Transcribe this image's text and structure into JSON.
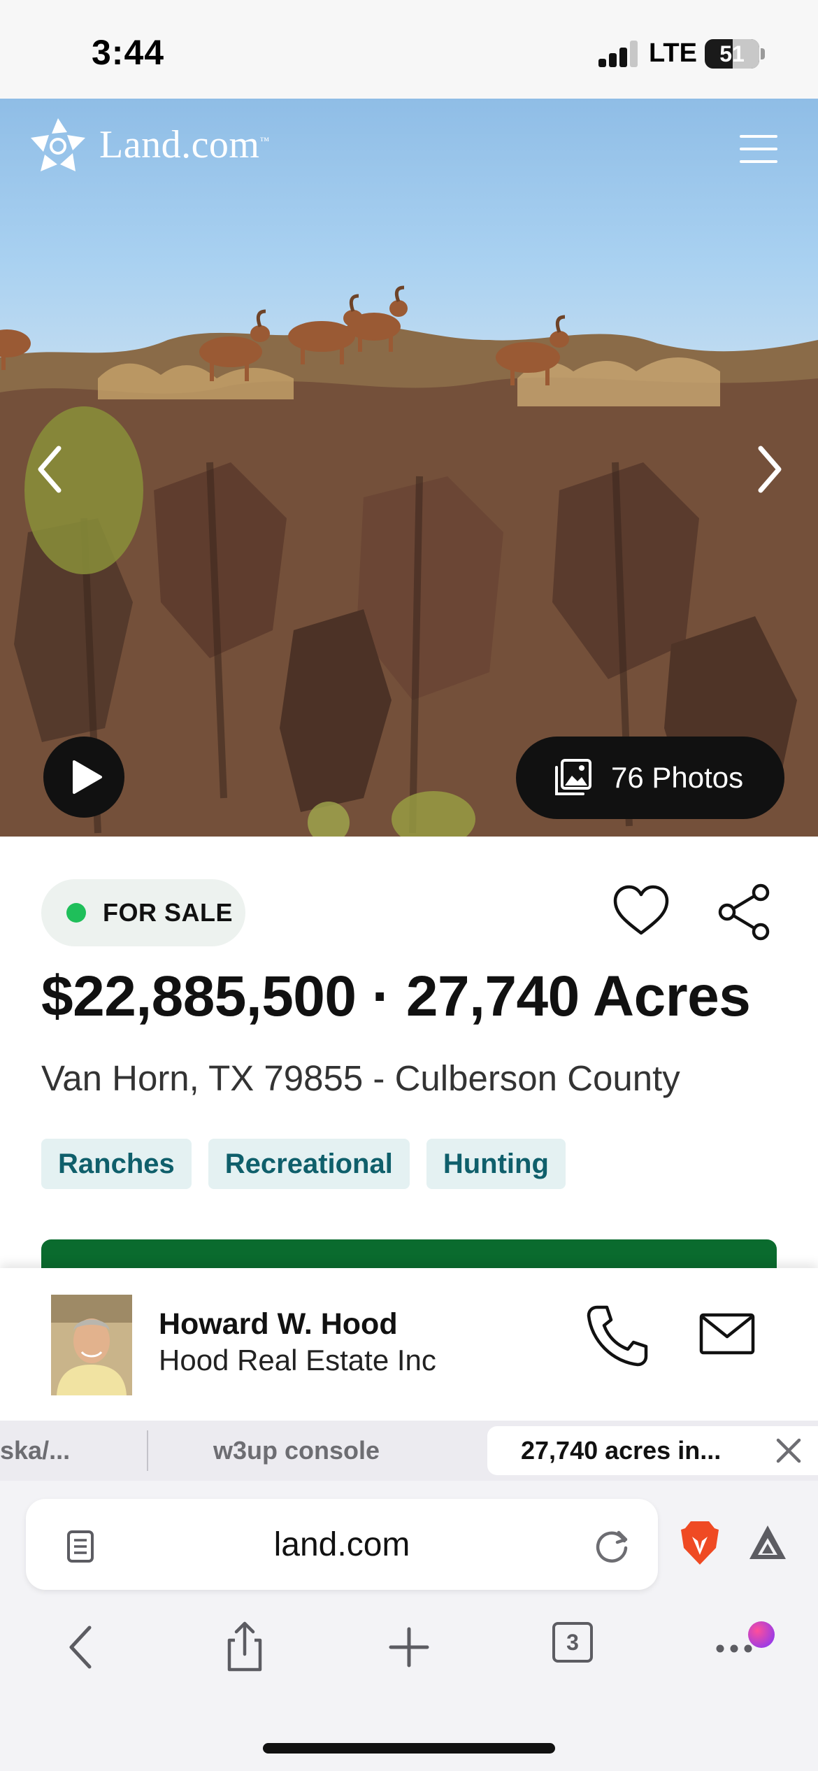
{
  "status_bar": {
    "time": "3:44",
    "network": "LTE",
    "battery_percent": "51",
    "battery_level": 0.51,
    "signal_bars": 3
  },
  "header": {
    "brand": "Land.com",
    "brand_mark": "™",
    "menu_icon": "hamburger-menu-icon"
  },
  "gallery": {
    "photos_label": "76 Photos",
    "prev_icon": "chevron-left-icon",
    "next_icon": "chevron-right-icon",
    "play_icon": "play-icon",
    "photos_icon": "photo-gallery-icon"
  },
  "listing": {
    "status": "FOR SALE",
    "price_line": "$22,885,500 · 27,740 Acres",
    "address": "Van Horn, TX 79855 - Culberson County",
    "tags": [
      "Ranches",
      "Recreational",
      "Hunting"
    ],
    "status_color": "#1fbf5a",
    "tag_color": "#0f5f6b",
    "cta_color": "#0a6b2e"
  },
  "agent": {
    "name": "Howard W. Hood",
    "company": "Hood Real Estate Inc",
    "call_icon": "phone-icon",
    "mail_icon": "mail-icon"
  },
  "browser": {
    "tabs": [
      {
        "label": "ska/..."
      },
      {
        "label": "w3up console"
      },
      {
        "label": "27,740 acres in...",
        "active": true
      }
    ],
    "url": "land.com",
    "tab_count": "3",
    "icons": [
      "reader-mode-icon",
      "reload-icon",
      "brave-shield-icon",
      "brave-rewards-icon",
      "back-icon",
      "share-icon",
      "new-tab-icon",
      "tabs-icon",
      "more-icon"
    ]
  }
}
